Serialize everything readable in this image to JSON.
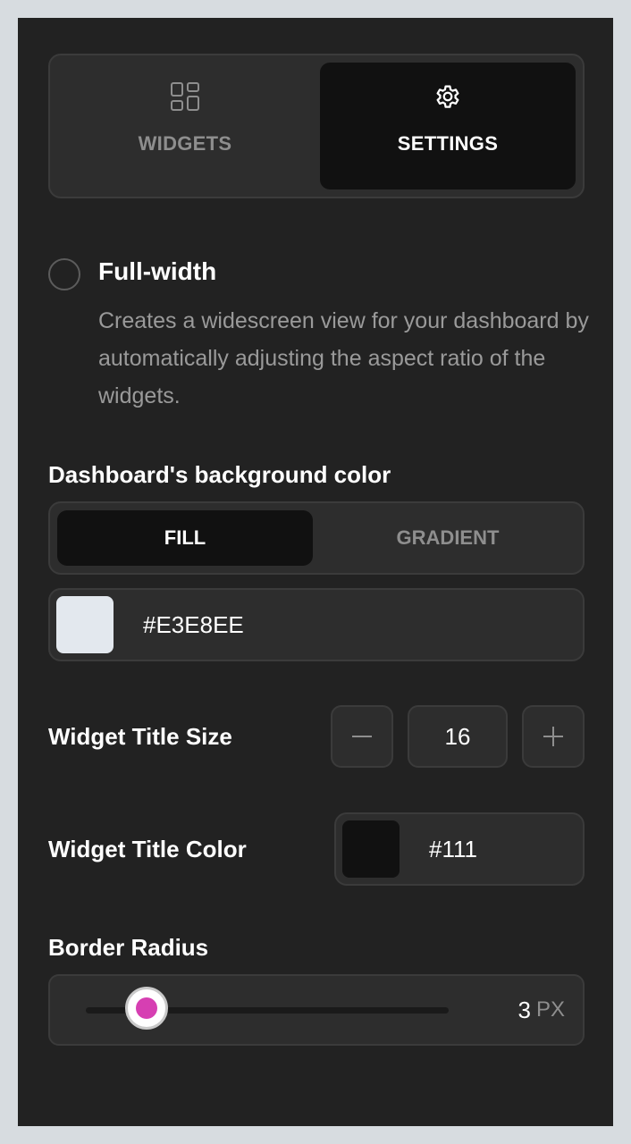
{
  "tabs": [
    {
      "label": "WIDGETS",
      "icon": "grid-icon",
      "active": false
    },
    {
      "label": "SETTINGS",
      "icon": "gear-icon",
      "active": true
    }
  ],
  "full_width": {
    "title": "Full-width",
    "description": "Creates a widescreen view for your dashboard by automatically adjusting the aspect ratio of the widgets.",
    "checked": false
  },
  "background": {
    "label": "Dashboard's background color",
    "modes": [
      "FILL",
      "GRADIENT"
    ],
    "active_mode": "FILL",
    "hex": "#E3E8EE",
    "swatch_color": "#E3E8EE"
  },
  "title_size": {
    "label": "Widget Title Size",
    "value": "16",
    "minus_icon": "minus-icon",
    "plus_icon": "plus-icon"
  },
  "title_color": {
    "label": "Widget Title Color",
    "hex": "#111",
    "swatch_color": "#111111"
  },
  "border_radius": {
    "label": "Border Radius",
    "value": "3",
    "unit": "PX",
    "fraction": 0.167,
    "accent_color": "#D63FB2"
  }
}
